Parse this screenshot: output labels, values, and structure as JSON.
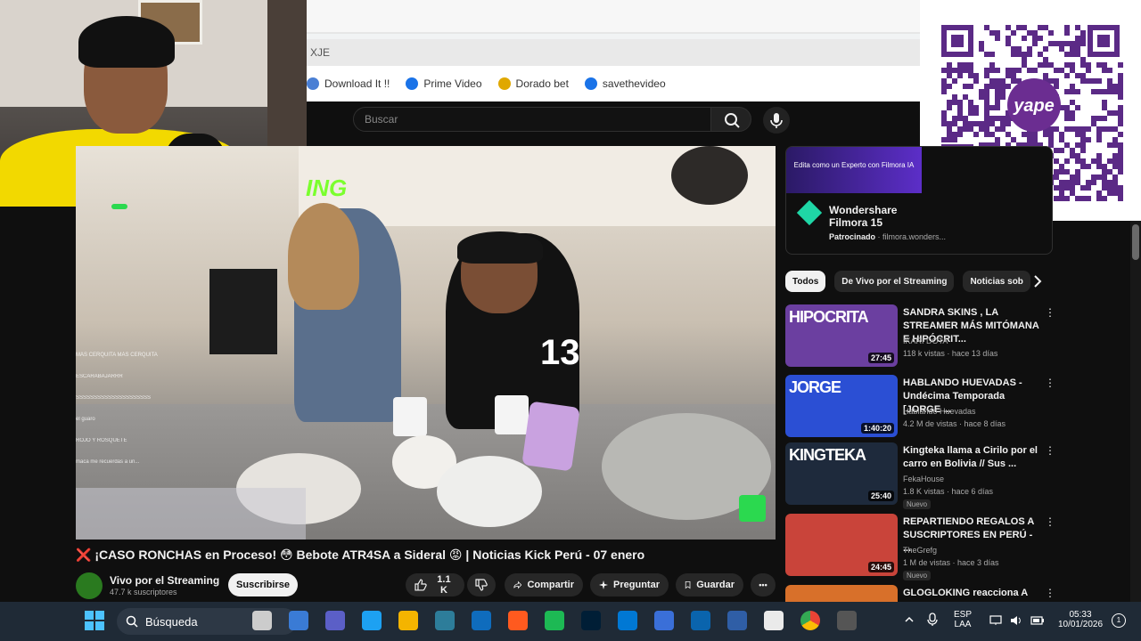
{
  "browser": {
    "url_fragment": "XJE",
    "bookmarks": [
      {
        "label": "Download It !!",
        "icon": "folder-icon",
        "color": "#4a7fd4"
      },
      {
        "label": "Prime Video",
        "icon": "play-circle-icon",
        "color": "#1a73e8"
      },
      {
        "label": "Dorado bet",
        "icon": "dorado-icon",
        "color": "#e0a800"
      },
      {
        "label": "savethevideo",
        "icon": "s-icon",
        "color": "#1a73e8"
      }
    ]
  },
  "youtube": {
    "search_placeholder": "Buscar",
    "video": {
      "overlay_text": "ING",
      "chat": [
        "MÁS CERQUITA MÁS CERQUITA",
        "ESCARABAJARRR",
        "SSSSSSSSSSSSSSSSSSSSS",
        "el guaro",
        "ROJO Y ROSQUETE",
        "maca me recuerdas a un..."
      ],
      "jersey_number": "13"
    },
    "title": "❌ ¡CASO RONCHAS en Proceso! 😳 Bebote ATR4SA a Sideral 😡 | Noticias Kick Perú - 07 enero",
    "channel": {
      "name": "Vivo por el Streaming",
      "subscribers": "47.7 k suscriptores",
      "subscribe_label": "Suscribirse"
    },
    "actions": {
      "likes": "1.1 K",
      "share": "Compartir",
      "ask": "Preguntar",
      "save": "Guardar",
      "more": "•••"
    },
    "ad": {
      "banner_text": "Edita como un Experto con Filmora IA",
      "name": "Wondershare Filmora 15",
      "sponsored": "Patrocinado",
      "sponsor_domain": "· filmora.wonders..."
    },
    "chips": [
      "Todos",
      "De Vivo por el Streaming",
      "Noticias sob"
    ],
    "recommendations": [
      {
        "title": "SANDRA SKINS , LA STREAMER MÁS MITÓMANA E HIPÓCRIT...",
        "channel": "IKARI DOTA",
        "meta": "118 k vistas · hace 13 días",
        "duration": "27:45",
        "thumb_text": "HIPOCRITA",
        "thumb_color": "#6b3fa0",
        "badge": ""
      },
      {
        "title": "HABLANDO HUEVADAS - Undécima Temporada [JORGE ...",
        "channel": "Hablando Huevadas",
        "meta": "4.2 M de vistas · hace 8 días",
        "duration": "1:40:20",
        "thumb_text": "JORGE",
        "thumb_color": "#2b4fd4",
        "badge": ""
      },
      {
        "title": "Kingteka llama a Cirilo por el carro en Bolivia // Sus ...",
        "channel": "FekaHouse",
        "meta": "1.8 K vistas · hace 6 días",
        "duration": "25:40",
        "thumb_text": "KINGTEKA",
        "thumb_color": "#1e2a3c",
        "badge": "Nuevo"
      },
      {
        "title": "REPARTIENDO REGALOS A SUSCRIPTORES EN PERÚ - ...",
        "channel": "TheGrefg",
        "meta": "1 M de vistas · hace 3 días",
        "duration": "24:45",
        "thumb_text": "",
        "thumb_color": "#c9443a",
        "badge": "Nuevo"
      },
      {
        "title": "GLOGLOKING reacciona A",
        "channel": "",
        "meta": "",
        "duration": "",
        "thumb_text": "",
        "thumb_color": "#d8702a",
        "badge": ""
      }
    ]
  },
  "taskbar": {
    "search_label": "Búsqueda",
    "lang": "ESP",
    "lang2": "LAA",
    "time": "05:33",
    "date": "10/01/2026",
    "notifications": "1"
  },
  "qr": {
    "brand": "yape"
  }
}
